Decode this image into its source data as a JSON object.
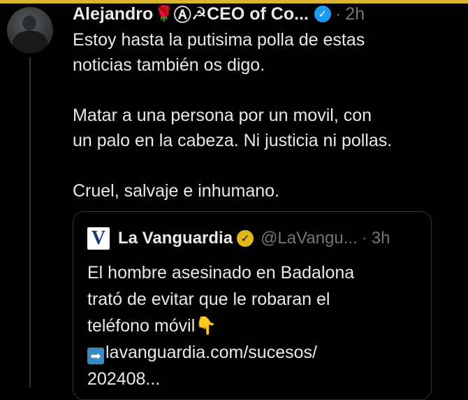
{
  "colors": {
    "background": "#000000",
    "text": "#e7e9ea",
    "muted": "#71767b",
    "verified_blue": "#1d9bf0",
    "verified_gold": "#e2b719",
    "top_bar": "#d9b431"
  },
  "tweet": {
    "avatar_icon": "user-avatar",
    "display_name": "Alejandro",
    "name_emoji_1": "🌹",
    "name_symbol": "Ⓐ",
    "name_suffix": "☭CEO of Co...",
    "verified_icon": "verified-badge-icon",
    "dot": "·",
    "time": "2h",
    "lines": [
      "Estoy hasta la putisima polla de estas",
      "noticias también os digo.",
      "",
      "Matar a una persona por un movil,  con",
      "un palo en la cabeza. Ni justicia ni pollas.",
      "",
      "Cruel, salvaje e inhumano."
    ]
  },
  "quote": {
    "logo_letter": "V",
    "display_name": "La Vanguardia",
    "verified_icon": "verified-gold-badge-icon",
    "handle": "@LaVangu...",
    "dot": "·",
    "time": "3h",
    "lines": [
      "El hombre asesinado en Badalona",
      "trató de evitar que le robaran el",
      "teléfono móvil"
    ],
    "pointing_emoji": "👇",
    "link_arrow": "➡",
    "link_line_1": "lavanguardia.com/sucesos/",
    "link_line_2": "202408..."
  }
}
